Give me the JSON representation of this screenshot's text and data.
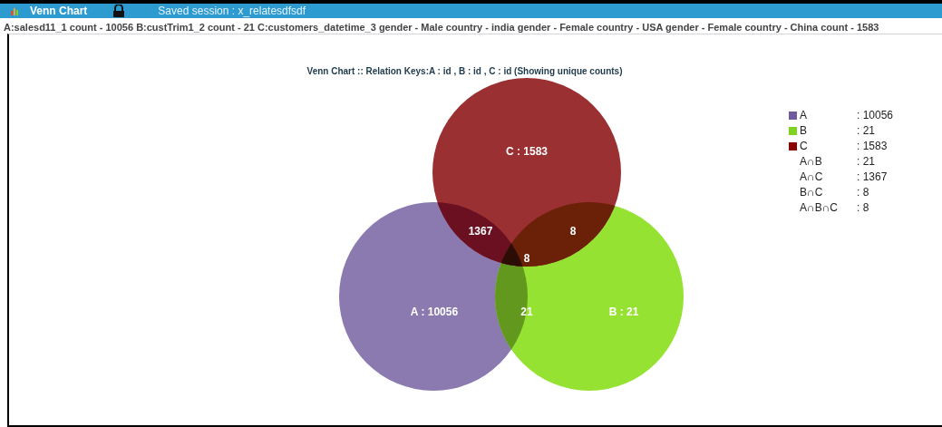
{
  "title_bar": {
    "title": "Venn Chart",
    "session": "Saved session : x_relatesdfsdf"
  },
  "info": "A:salesd11_1 count - 10056 B:custTrim1_2 count - 21 C:customers_datetime_3 gender - Male country - india gender - Female country - USA gender - Female country - China count - 1583",
  "chart_title": "Venn Chart :: Relation Keys:A : id , B : id , C : id (Showing unique counts)",
  "sets": [
    {
      "label": "A : 10056",
      "color": "#8b7ab0"
    },
    {
      "label": "B : 21",
      "color": "#95e232"
    },
    {
      "label": "C : 1583",
      "color": "#9b3033"
    }
  ],
  "region_labels": [
    {
      "kind": "ab",
      "text": "21"
    },
    {
      "kind": "ac",
      "text": "1367"
    },
    {
      "kind": "bc",
      "text": "8"
    },
    {
      "kind": "abc",
      "text": "8"
    }
  ],
  "legend": [
    {
      "name": "A",
      "value": ": 10056",
      "color": "#6f5a9e"
    },
    {
      "name": "B",
      "value": ": 21",
      "color": "#7ed321"
    },
    {
      "name": "C",
      "value": ": 1583",
      "color": "#8b0000"
    },
    {
      "name": "A∩B",
      "value": ": 21"
    },
    {
      "name": "A∩C",
      "value": ": 1367"
    },
    {
      "name": "B∩C",
      "value": ": 8"
    },
    {
      "name": "A∩B∩C",
      "value": ": 8"
    }
  ]
}
